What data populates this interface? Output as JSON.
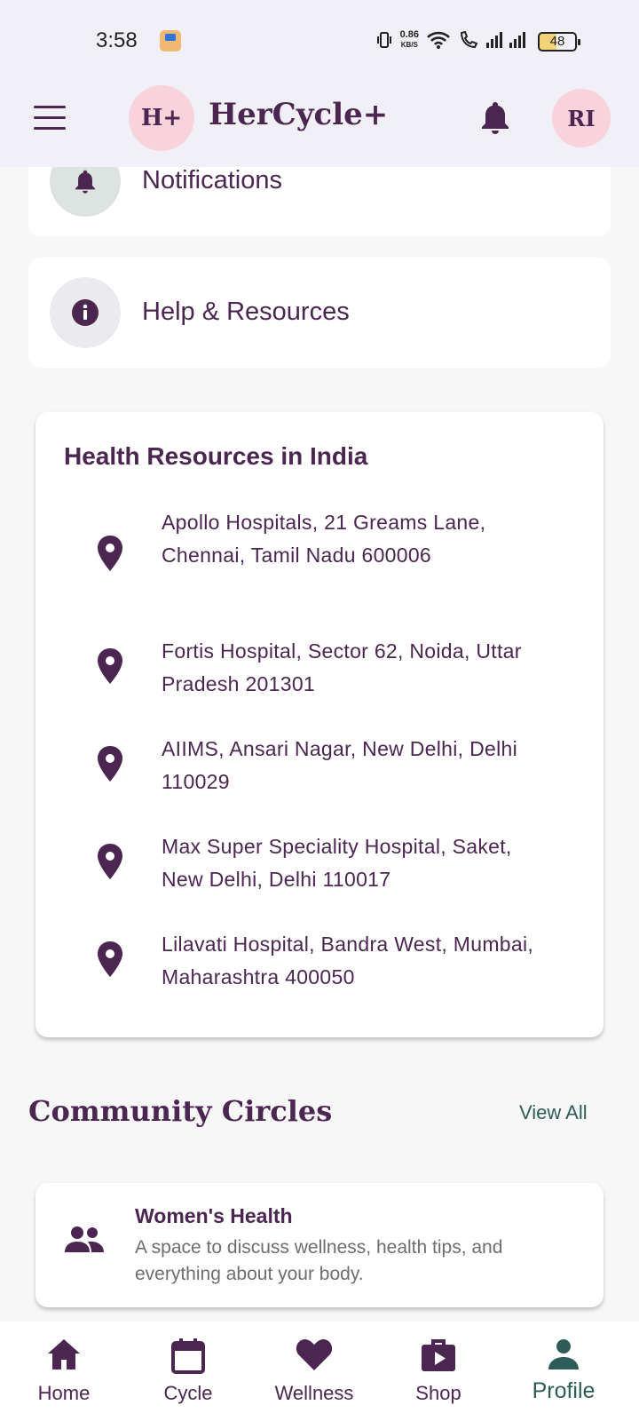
{
  "status_bar": {
    "time": "3:58",
    "net_speed": "0.86",
    "net_unit": "KB/S",
    "battery": "48"
  },
  "app_bar": {
    "logo_text": "H+",
    "title": "HerCycle+",
    "avatar_initials": "RI"
  },
  "menu": {
    "notifications_label": "Notifications",
    "help_label": "Help & Resources"
  },
  "health_resources": {
    "title": "Health Resources in India",
    "items": [
      {
        "address": "Apollo Hospitals, 21 Greams Lane, Chennai, Tamil Nadu 600006"
      },
      {
        "address": "Fortis Hospital, Sector 62, Noida, Uttar Pradesh 201301"
      },
      {
        "address": "AIIMS, Ansari Nagar, New Delhi, Delhi 110029"
      },
      {
        "address": "Max Super Speciality Hospital, Saket, New Delhi, Delhi 110017"
      },
      {
        "address": "Lilavati Hospital, Bandra West, Mumbai, Maharashtra 400050"
      }
    ]
  },
  "community": {
    "title": "Community Circles",
    "view_all": "View All",
    "circles": [
      {
        "name": "Women's Health",
        "description": "A space to discuss wellness, health tips, and everything about your body."
      }
    ]
  },
  "bottom_nav": {
    "items": [
      {
        "label": "Home",
        "icon": "home-icon"
      },
      {
        "label": "Cycle",
        "icon": "calendar-icon"
      },
      {
        "label": "Wellness",
        "icon": "heart-icon"
      },
      {
        "label": "Shop",
        "icon": "shop-bag-icon"
      },
      {
        "label": "Profile",
        "icon": "person-icon"
      }
    ],
    "active": "Profile"
  },
  "colors": {
    "primary": "#4a2650",
    "accent": "#2e5d57",
    "pink": "#f8d3dc",
    "appbar_bg": "#f1f0f6"
  }
}
